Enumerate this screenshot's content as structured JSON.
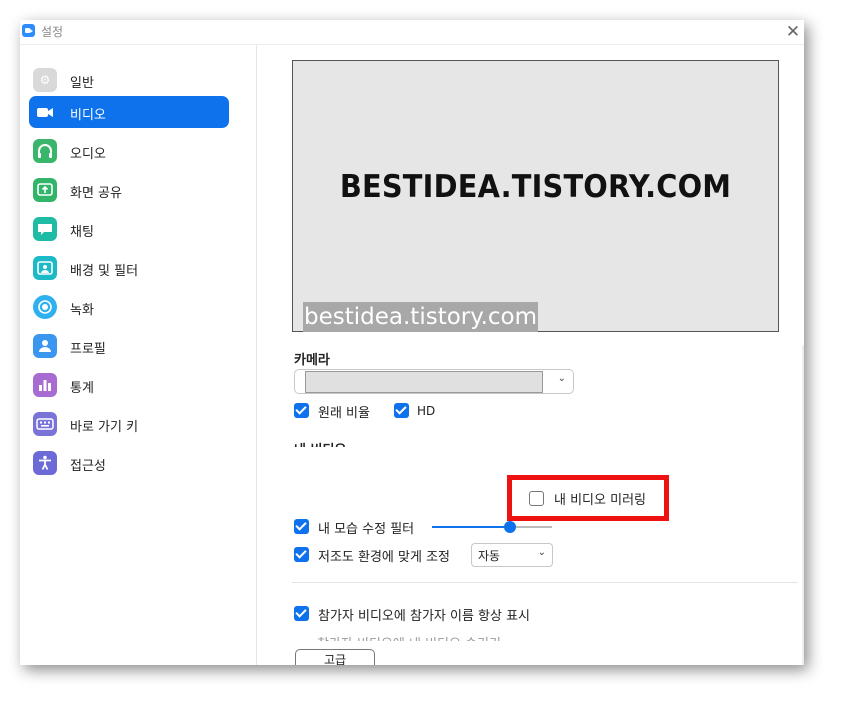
{
  "window": {
    "title": "설정",
    "close_symbol": "✕"
  },
  "sidebar": {
    "active_index": 1,
    "items": [
      {
        "label": "일반",
        "icon": "gear-icon",
        "color": "#d9d9d9",
        "glyph": "⚙"
      },
      {
        "label": "비디오",
        "icon": "video-camera-icon",
        "color": "#ffffff",
        "glyph": "■"
      },
      {
        "label": "오디오",
        "icon": "headphones-icon",
        "color": "#39b66b",
        "glyph": "∩"
      },
      {
        "label": "화면 공유",
        "icon": "share-screen-icon",
        "color": "#31b569",
        "glyph": "↑"
      },
      {
        "label": "채팅",
        "icon": "chat-bubble-icon",
        "color": "#1ebba5",
        "glyph": "▬"
      },
      {
        "label": "배경 및 필터",
        "icon": "background-icon",
        "color": "#1cb9c7",
        "glyph": "▲"
      },
      {
        "label": "녹화",
        "icon": "record-icon",
        "color": "#2fb0f0",
        "glyph": "●"
      },
      {
        "label": "프로필",
        "icon": "profile-icon",
        "color": "#3a96ee",
        "glyph": "●"
      },
      {
        "label": "통계",
        "icon": "statistics-icon",
        "color": "#a86bd1",
        "glyph": "▮"
      },
      {
        "label": "바로 가기 키",
        "icon": "keyboard-icon",
        "color": "#7a73d8",
        "glyph": "▦"
      },
      {
        "label": "접근성",
        "icon": "accessibility-icon",
        "color": "#6b6ad6",
        "glyph": "✚"
      }
    ]
  },
  "preview": {
    "main_text": "BESTIDEA.TISTORY.COM",
    "watermark_text": "bestidea.tistory.com"
  },
  "camera": {
    "section_label": "카메라",
    "selected_value": ""
  },
  "options": {
    "original_ratio": {
      "label": "원래 비율",
      "checked": true
    },
    "hd": {
      "label": "HD",
      "checked": true
    }
  },
  "my_video": {
    "section_label": "내 비디오",
    "mirror": {
      "label": "내 비디오 미러링",
      "checked": false
    },
    "touch_up": {
      "label": "내 모습 수정 필터",
      "checked": true,
      "level": 0.65
    },
    "low_light": {
      "label": "저조도 환경에 맞게 조정",
      "checked": true,
      "mode": "자동"
    }
  },
  "participants": {
    "show_names": {
      "label": "참가자 비디오에 참가자 이름 항상 표시",
      "checked": true
    },
    "next_option_partial": "참가자 비디오에 내 비디오 숨기기"
  },
  "advanced_button": "고급",
  "colors": {
    "accent": "#0e72ed",
    "highlight": "#ee1111"
  }
}
